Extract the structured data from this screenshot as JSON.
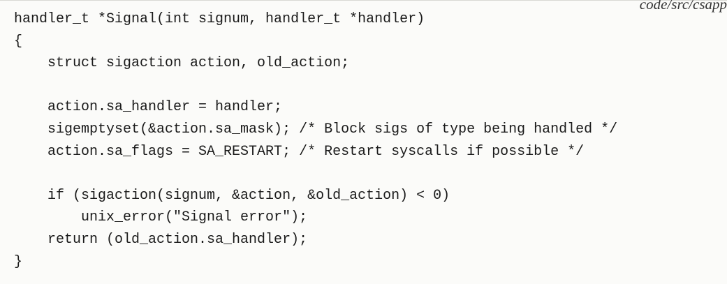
{
  "header": {
    "file_path": "code/src/csapp"
  },
  "code": {
    "lines": [
      "handler_t *Signal(int signum, handler_t *handler)",
      "{",
      "    struct sigaction action, old_action;",
      "",
      "    action.sa_handler = handler;",
      "    sigemptyset(&action.sa_mask); /* Block sigs of type being handled */",
      "    action.sa_flags = SA_RESTART; /* Restart syscalls if possible */",
      "",
      "    if (sigaction(signum, &action, &old_action) < 0)",
      "        unix_error(\"Signal error\");",
      "    return (old_action.sa_handler);",
      "}"
    ]
  }
}
